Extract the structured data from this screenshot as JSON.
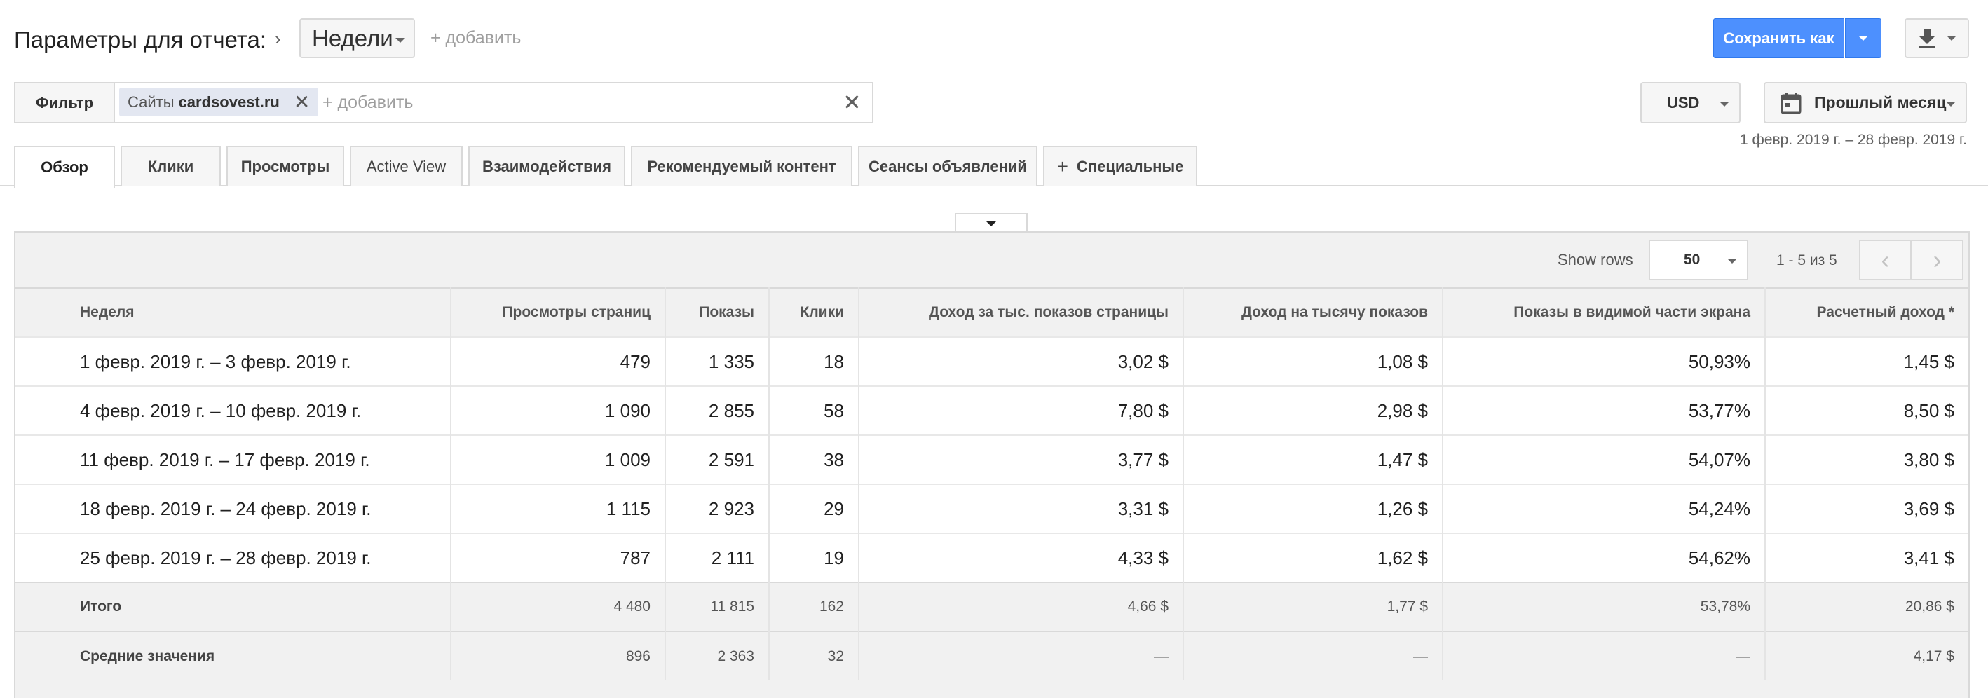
{
  "header": {
    "title": "Параметры для отчета:",
    "chevron": "›",
    "dimension_selected": "Недели",
    "add_label": "+ добавить",
    "save_label": "Сохранить как"
  },
  "filter": {
    "label": "Фильтр",
    "chip_prefix": "Сайты",
    "chip_value": "cardsovest.ru",
    "chip_remove": "✕",
    "add_label": "+ добавить",
    "clear": "✕"
  },
  "currency": "USD",
  "date_filter": {
    "label": "Прошлый месяц",
    "range": "1 февр. 2019 г. – 28 февр. 2019 г."
  },
  "tabs": [
    {
      "label": "Обзор",
      "active": true
    },
    {
      "label": "Клики"
    },
    {
      "label": "Просмотры"
    },
    {
      "label": "Active View"
    },
    {
      "label": "Взаимодействия"
    },
    {
      "label": "Рекомендуемый контент"
    },
    {
      "label": "Сеансы объявлений"
    },
    {
      "label": "Специальные",
      "icon": "+"
    }
  ],
  "table": {
    "show_rows_label": "Show rows",
    "rows_per_page": "50",
    "pager_text": "1 - 5 из 5",
    "prev": "‹",
    "next": "›",
    "columns": [
      "Неделя",
      "Просмотры страниц",
      "Показы",
      "Клики",
      "Доход за тыс. показов страницы",
      "Доход на тысячу показов",
      "Показы в видимой части экрана",
      "Расчетный доход *"
    ],
    "rows": [
      [
        "1 февр. 2019 г. – 3 февр. 2019 г.",
        "479",
        "1 335",
        "18",
        "3,02 $",
        "1,08 $",
        "50,93%",
        "1,45 $"
      ],
      [
        "4 февр. 2019 г. – 10 февр. 2019 г.",
        "1 090",
        "2 855",
        "58",
        "7,80 $",
        "2,98 $",
        "53,77%",
        "8,50 $"
      ],
      [
        "11 февр. 2019 г. – 17 февр. 2019 г.",
        "1 009",
        "2 591",
        "38",
        "3,77 $",
        "1,47 $",
        "54,07%",
        "3,80 $"
      ],
      [
        "18 февр. 2019 г. – 24 февр. 2019 г.",
        "1 115",
        "2 923",
        "29",
        "3,31 $",
        "1,26 $",
        "54,24%",
        "3,69 $"
      ],
      [
        "25 февр. 2019 г. – 28 февр. 2019 г.",
        "787",
        "2 111",
        "19",
        "4,33 $",
        "1,62 $",
        "54,62%",
        "3,41 $"
      ]
    ],
    "totals": [
      "Итого",
      "4 480",
      "11 815",
      "162",
      "4,66 $",
      "1,77 $",
      "53,78%",
      "20,86 $"
    ],
    "averages": [
      "Средние значения",
      "896",
      "2 363",
      "32",
      "—",
      "—",
      "—",
      "4,17 $"
    ]
  }
}
